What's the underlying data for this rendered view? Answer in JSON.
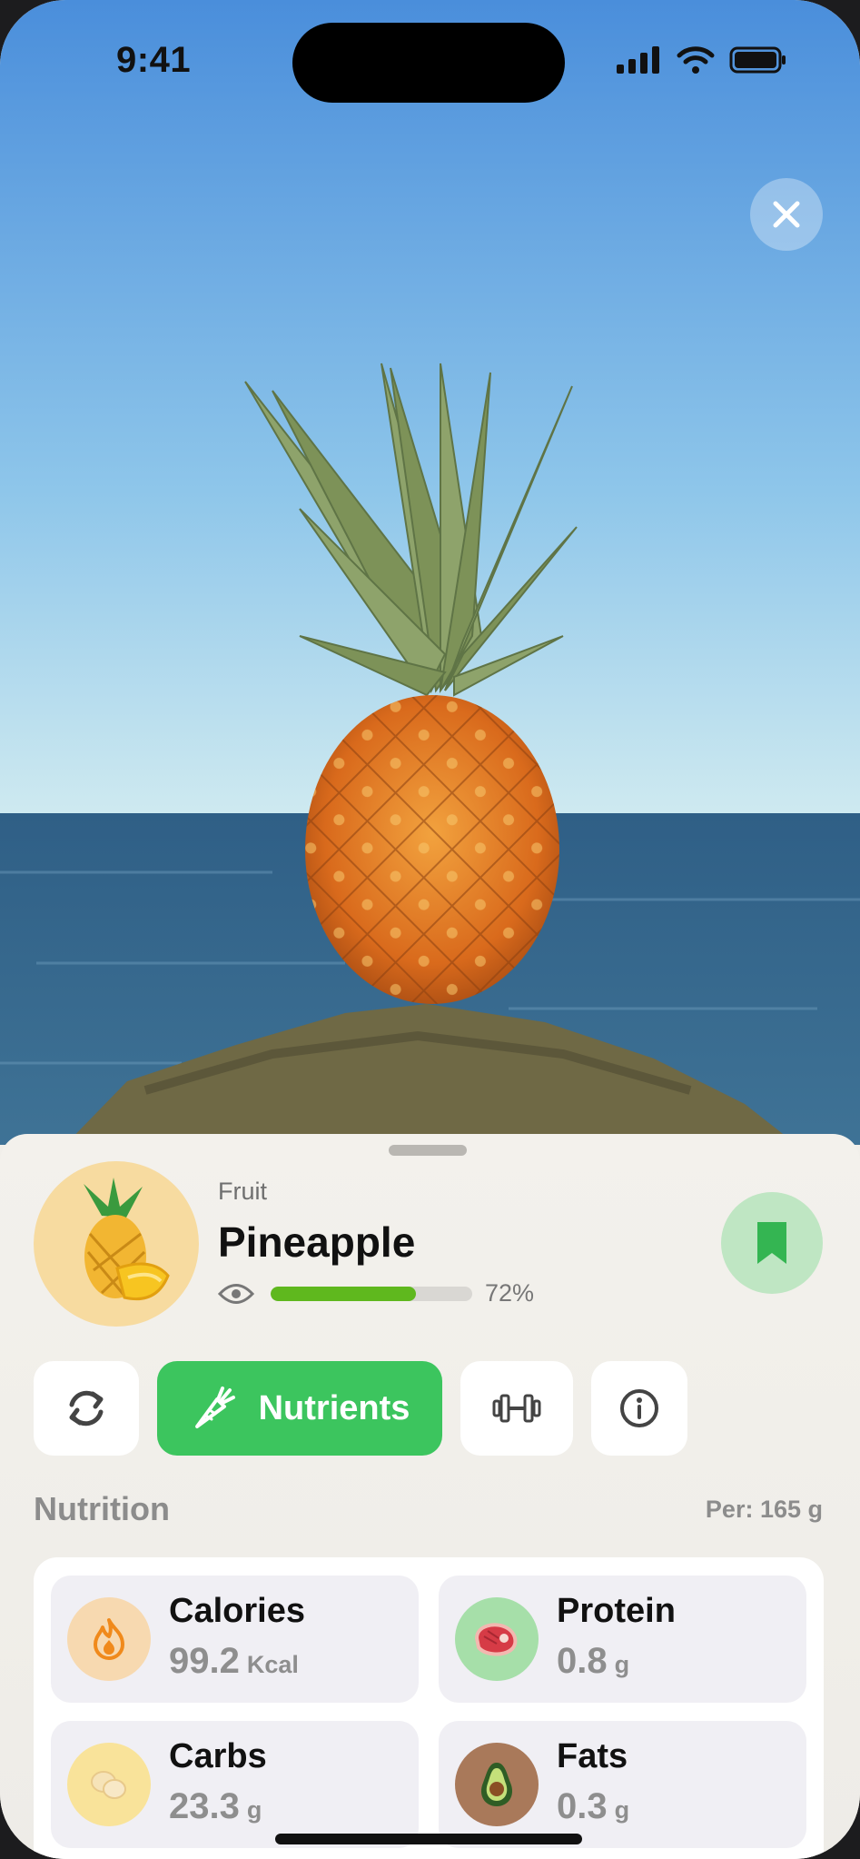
{
  "status_bar": {
    "time": "9:41"
  },
  "food": {
    "category": "Fruit",
    "name": "Pineapple",
    "confidence_label": "72%",
    "confidence_fraction": 0.72
  },
  "tabs": [
    {
      "icon": "refresh-icon"
    },
    {
      "icon": "carrot-icon",
      "label": "Nutrients",
      "active": true
    },
    {
      "icon": "dumbbell-icon"
    },
    {
      "icon": "info-icon"
    }
  ],
  "nutrition": {
    "title": "Nutrition",
    "per": "Per: 165 g",
    "items": [
      {
        "name": "Calories",
        "value": "99.2",
        "unit": "Kcal",
        "icon": "flame-icon",
        "icon_bg": "#f7d9b0"
      },
      {
        "name": "Protein",
        "value": "0.8",
        "unit": "g",
        "icon": "steak-icon",
        "icon_bg": "#a6dfa9"
      },
      {
        "name": "Carbs",
        "value": "23.3",
        "unit": "g",
        "icon": "potato-icon",
        "icon_bg": "#f9e39a"
      },
      {
        "name": "Fats",
        "value": "0.3",
        "unit": "g",
        "icon": "avocado-icon",
        "icon_bg": "#a9795a"
      }
    ]
  },
  "colors": {
    "accent": "#3cc55e",
    "bookmark_bg": "#bfe6c3",
    "progress": "#5fb81e"
  }
}
